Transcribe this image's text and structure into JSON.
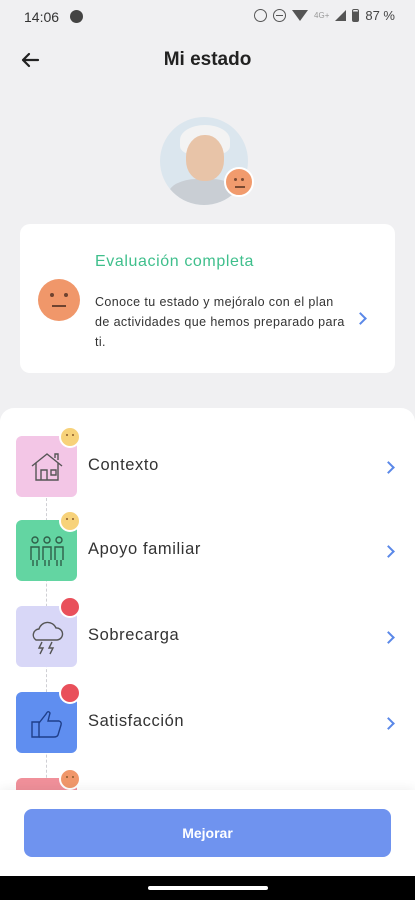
{
  "status_bar": {
    "time": "14:06",
    "battery": "87 %",
    "network": "4G+"
  },
  "header": {
    "title": "Mi estado"
  },
  "evaluation": {
    "title": "Evaluación completa",
    "text": "Conoce tu estado y mejóralo con el plan de actividades que hemos preparado para ti."
  },
  "items": [
    {
      "label": "Contexto",
      "mood": "neutral"
    },
    {
      "label": "Apoyo familiar",
      "mood": "neutral"
    },
    {
      "label": "Sobrecarga",
      "mood": "bad"
    },
    {
      "label": "Satisfacción",
      "mood": "bad"
    },
    {
      "label": "",
      "mood": "moderate"
    }
  ],
  "action": {
    "label": "Mejorar"
  },
  "colors": {
    "accent_green": "#3fbf8c",
    "accent_blue": "#6f93ef",
    "mood_bad": "#e9505b",
    "mood_neutral": "#f7d27a",
    "mood_moderate": "#f0976a"
  }
}
